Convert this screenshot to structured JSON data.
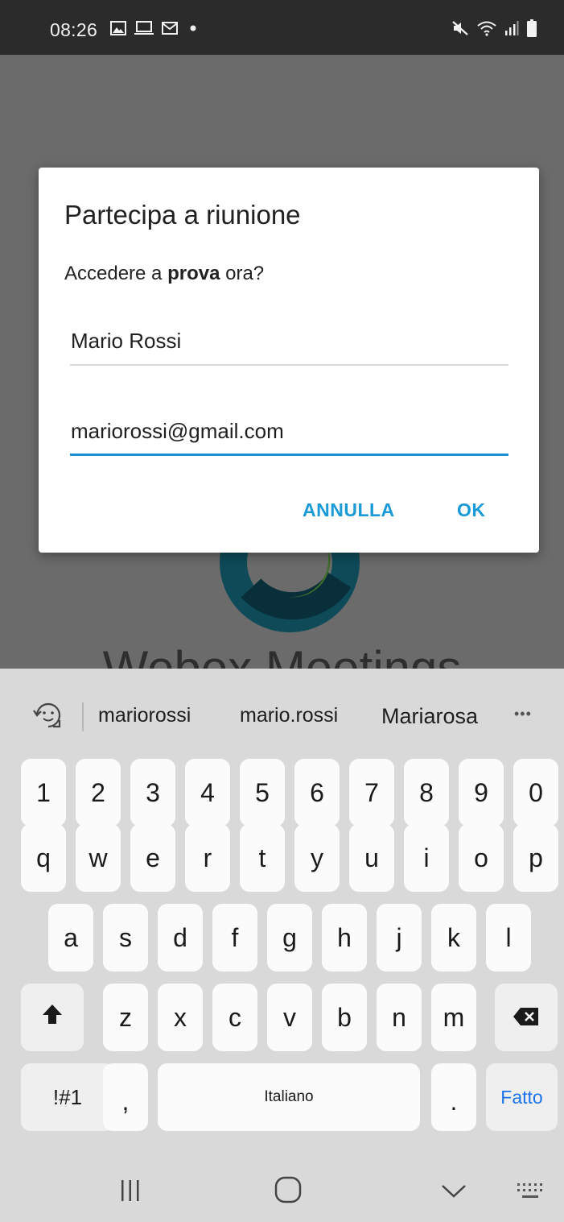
{
  "status_bar": {
    "time": "08:26",
    "left_icons": [
      "image-icon",
      "laptop-icon",
      "gmail-icon",
      "dot-icon"
    ],
    "right_icons": [
      "mute-icon",
      "wifi-icon",
      "signal-icon",
      "battery-icon"
    ]
  },
  "dialog": {
    "title": "Partecipa a riunione",
    "message_prefix": "Accedere a ",
    "message_bold": "prova",
    "message_suffix": " ora?",
    "name_value": "Mario Rossi",
    "email_value": "mariorossi@gmail.com",
    "cancel_label": "ANNULLA",
    "ok_label": "OK"
  },
  "background": {
    "title_partial": "Webex Meetings"
  },
  "keyboard": {
    "suggestions": [
      "mariorossi",
      "mario.rossi",
      "Mariarosa"
    ],
    "more_label": "•••",
    "number_row": [
      "1",
      "2",
      "3",
      "4",
      "5",
      "6",
      "7",
      "8",
      "9",
      "0"
    ],
    "row1": [
      "q",
      "w",
      "e",
      "r",
      "t",
      "y",
      "u",
      "i",
      "o",
      "p"
    ],
    "row2": [
      "a",
      "s",
      "d",
      "f",
      "g",
      "h",
      "j",
      "k",
      "l"
    ],
    "row3": [
      "z",
      "x",
      "c",
      "v",
      "b",
      "n",
      "m"
    ],
    "symbols_label": "!#1",
    "comma_label": ",",
    "space_label": "Italiano",
    "period_label": ".",
    "done_label": "Fatto",
    "colors": {
      "done": "#1a73e8",
      "accent": "#1a9ad6"
    }
  }
}
